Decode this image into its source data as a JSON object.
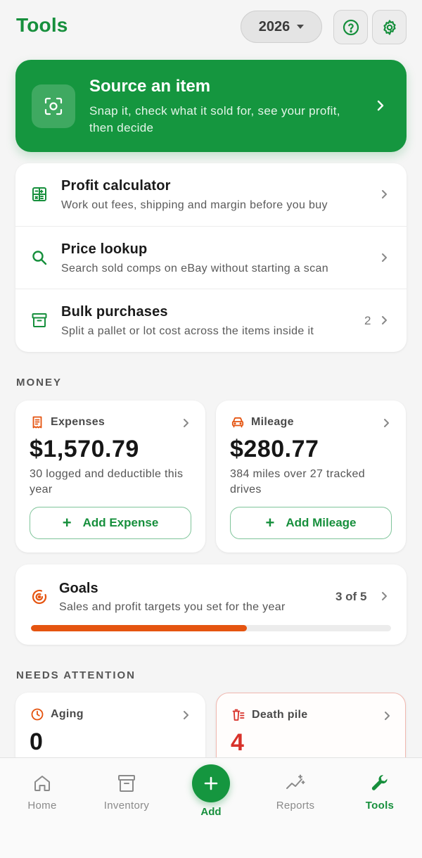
{
  "header": {
    "title": "Tools",
    "year": "2026"
  },
  "source": {
    "title": "Source an item",
    "subtitle": "Snap it, check what it sold for, see your profit, then decide"
  },
  "tools": [
    {
      "name": "Profit calculator",
      "desc": "Work out fees, shipping and margin before you buy",
      "icon": "calculator-icon"
    },
    {
      "name": "Price lookup",
      "desc": "Search sold comps on eBay without starting a scan",
      "icon": "search-icon"
    },
    {
      "name": "Bulk purchases",
      "desc": "Split a pallet or lot cost across the items inside it",
      "icon": "archive-box-icon",
      "count": "2"
    }
  ],
  "money": {
    "section_label": "MONEY",
    "expenses": {
      "label": "Expenses",
      "value": "$1,570.79",
      "sub": "30 logged and deductible this year",
      "button": "Add Expense"
    },
    "mileage": {
      "label": "Mileage",
      "value": "$280.77",
      "sub": "384 miles over 27 tracked drives",
      "button": "Add Mileage"
    }
  },
  "goals": {
    "title": "Goals",
    "subtitle": "Sales and profit targets you set for the year",
    "count": "3 of 5",
    "progress": 0.6
  },
  "attention": {
    "section_label": "NEEDS ATTENTION",
    "aging": {
      "label": "Aging",
      "value": "0"
    },
    "death_pile": {
      "label": "Death pile",
      "value": "4"
    }
  },
  "nav": {
    "home": "Home",
    "inventory": "Inventory",
    "add": "Add",
    "reports": "Reports",
    "tools": "Tools"
  },
  "colors": {
    "brand_green": "#15963f",
    "accent_orange": "#e55410",
    "danger_red": "#d8322a"
  }
}
